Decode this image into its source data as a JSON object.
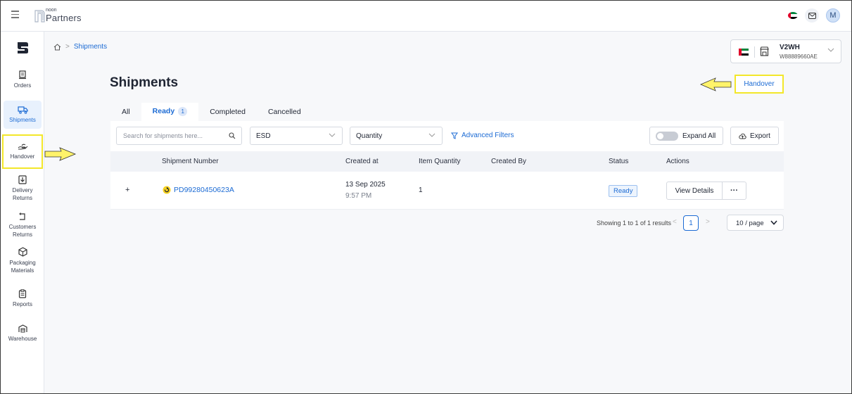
{
  "header": {
    "brand_small": "noon",
    "brand_big": "Partners",
    "avatar_initial": "M"
  },
  "sidebar": {
    "items": [
      {
        "label": "Orders"
      },
      {
        "label": "Shipments"
      },
      {
        "label": "Handover"
      },
      {
        "label_line1": "Delivery",
        "label_line2": "Returns"
      },
      {
        "label_line1": "Customers",
        "label_line2": "Returns"
      },
      {
        "label_line1": "Packaging",
        "label_line2": "Materials"
      },
      {
        "label": "Reports"
      },
      {
        "label": "Warehouse"
      }
    ]
  },
  "breadcrumb": {
    "current": "Shipments",
    "separator": ">"
  },
  "store": {
    "name": "V2WH",
    "code": "W88889660AE"
  },
  "page": {
    "title": "Shipments",
    "handover_button": "Handover"
  },
  "tabs": [
    {
      "label": "All"
    },
    {
      "label": "Ready",
      "badge": "1"
    },
    {
      "label": "Completed"
    },
    {
      "label": "Cancelled"
    }
  ],
  "filters": {
    "search_placeholder": "Search for shipments here...",
    "select1_value": "ESD",
    "select2_value": "Quantity",
    "advanced_filters": "Advanced Filters",
    "expand_all": "Expand All",
    "export": "Export"
  },
  "table": {
    "columns": [
      "Shipment Number",
      "Created at",
      "Item Quantity",
      "Created By",
      "Status",
      "Actions"
    ],
    "rows": [
      {
        "expand": "+",
        "shipment_number": "PD99280450623A",
        "created_date": "13 Sep 2025",
        "created_time": "9:57 PM",
        "item_quantity": "1",
        "created_by": "",
        "status": "Ready",
        "view_details": "View Details",
        "more": "···"
      }
    ]
  },
  "pagination": {
    "summary": "Showing 1 to 1 of 1 results",
    "prev": "<",
    "current_page": "1",
    "next": ">",
    "page_size": "10 / page"
  },
  "colors": {
    "accent": "#1c6bd4",
    "highlight": "#f3e72a",
    "uae_red": "#e0002a",
    "uae_green": "#00843d"
  }
}
